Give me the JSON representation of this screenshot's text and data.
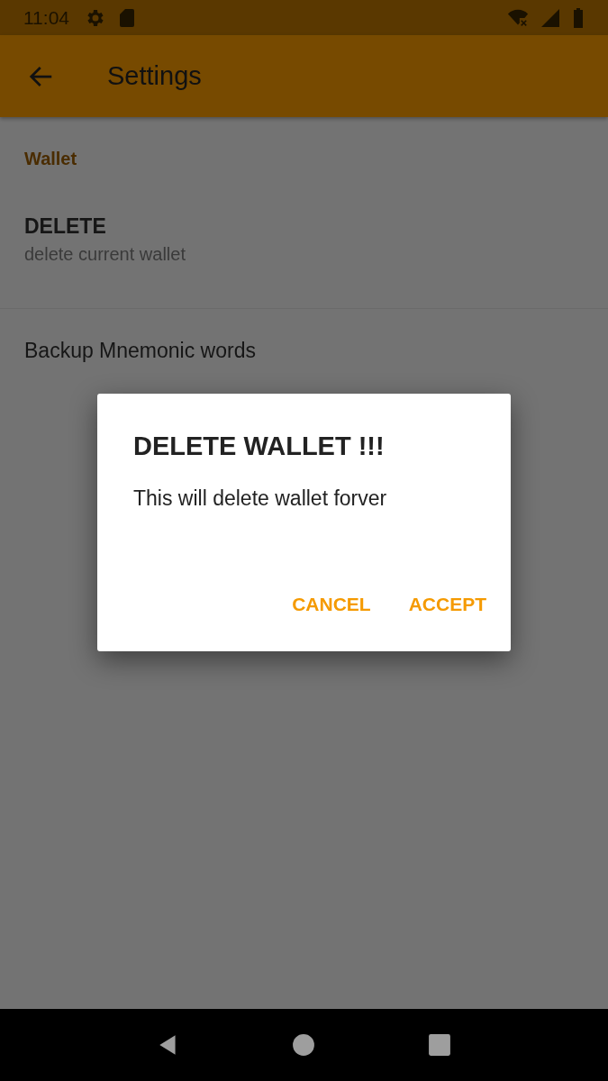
{
  "status_bar": {
    "time": "11:04"
  },
  "app_bar": {
    "title": "Settings"
  },
  "sections": [
    {
      "title": "Wallet",
      "items": [
        {
          "title": "DELETE",
          "subtitle": "delete current wallet"
        },
        {
          "title": "Backup Mnemonic words"
        }
      ]
    }
  ],
  "dialog": {
    "title": "DELETE WALLET !!!",
    "message": "This will delete wallet forver",
    "buttons": [
      "CANCEL",
      "ACCEPT"
    ]
  }
}
